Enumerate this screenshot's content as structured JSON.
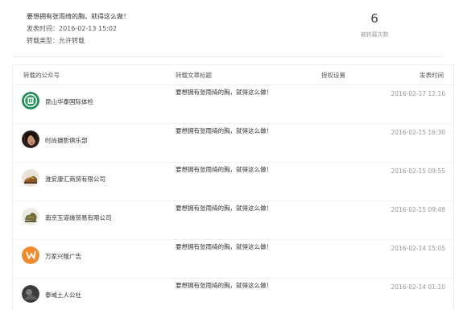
{
  "summary": {
    "article_title": "要想拥有张雨绮的胸，就得这么做！",
    "publish_time": "发表时间：2016-02-13 15:02",
    "repost_type": "转载类型：允许转载",
    "repost_count": "6",
    "repost_count_label": "被转载次数"
  },
  "table": {
    "headers": {
      "account": "转载的公众号",
      "article": "转载文章标题",
      "auth": "授权设置",
      "time": "发表时间"
    },
    "rows": [
      {
        "avatar_icon": "rainbow-emblem-logo-icon",
        "account": "昆山华泰国际体检",
        "title": "要想拥有张雨绮的胸，就得这么做！",
        "time": "2016-02-17 12:16"
      },
      {
        "avatar_icon": "portrait-photo-icon",
        "account": "时尚摄影俱乐部",
        "title": "要想拥有张雨绮的胸，就得这么做！",
        "time": "2016-02-15 16:30"
      },
      {
        "avatar_icon": "golden-figure-icon",
        "account": "淮安康汇商贸有限公司",
        "title": "要想拥有张雨绮的胸，就得这么做！",
        "time": "2016-02-15 09:55"
      },
      {
        "avatar_icon": "jade-carving-icon",
        "account": "南京玉道缘贸易有限公司",
        "title": "要想拥有张雨绮的胸，就得这么做！",
        "time": "2016-02-15 09:48"
      },
      {
        "avatar_icon": "orange-brand-logo-icon",
        "account": "万家兴隆广告",
        "title": "要想拥有张雨绮的胸，就得这么做！",
        "time": "2016-02-14 15:05"
      },
      {
        "avatar_icon": "dark-photo-icon",
        "account": "泰域土人公社",
        "title": "要想拥有张雨绮的胸，就得这么做！",
        "time": "2016-02-14 01:10"
      }
    ]
  }
}
